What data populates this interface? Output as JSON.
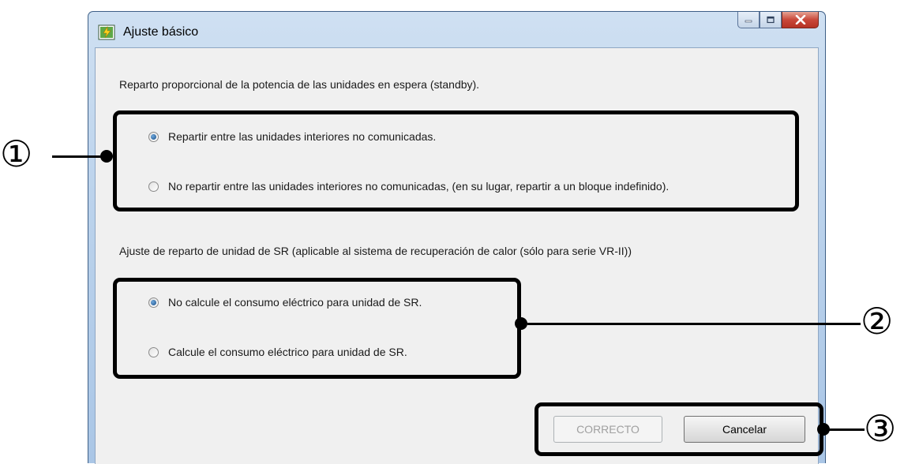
{
  "window": {
    "title": "Ajuste básico",
    "app_icon": "settings-app-icon",
    "controls": [
      "minimize-icon",
      "maximize-icon",
      "close-icon"
    ]
  },
  "section1": {
    "label": "Reparto proporcional de la potencia de las unidades en espera (standby).",
    "options": [
      {
        "label": "Repartir entre las unidades interiores no comunicadas.",
        "selected": true
      },
      {
        "label": "No repartir entre las unidades interiores no comunicadas, (en su lugar, repartir a un bloque indefinido).",
        "selected": false
      }
    ]
  },
  "section2": {
    "label": "Ajuste de reparto de unidad de SR (aplicable al sistema de recuperación de calor (sólo para serie VR-II))",
    "options": [
      {
        "label": "No calcule el consumo eléctrico para unidad de SR.",
        "selected": true
      },
      {
        "label": "Calcule el consumo eléctrico para unidad de SR.",
        "selected": false
      }
    ]
  },
  "buttons": {
    "ok_label": "CORRECTO",
    "ok_enabled": false,
    "cancel_label": "Cancelar"
  },
  "annotations": [
    "①",
    "②",
    "③"
  ],
  "colors": {
    "client_bg": "#f0f0f0",
    "frame": "#bcd3ec",
    "close_button": "#c9483a",
    "annotation": "#000000"
  }
}
